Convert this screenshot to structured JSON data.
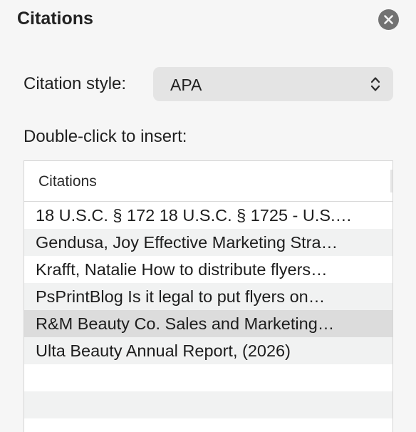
{
  "panel": {
    "title": "Citations"
  },
  "citation_style": {
    "label": "Citation style:",
    "selected": "APA"
  },
  "list": {
    "instruction": "Double-click to insert:",
    "column_header": "Citations",
    "items": [
      {
        "text": "18 U.S.C. § 172 18 U.S.C. § 1725 - U.S.…"
      },
      {
        "text": "Gendusa, Joy Effective Marketing Stra…"
      },
      {
        "text": "Krafft, Natalie How to distribute flyers…"
      },
      {
        "text": "PsPrintBlog Is it legal to put flyers on…"
      },
      {
        "text": "R&M Beauty Co. Sales and Marketing…"
      },
      {
        "text": "Ulta Beauty Annual Report, (2026)"
      }
    ]
  },
  "colors": {
    "panel_bg": "#f6f6f6",
    "selected_row": "#dcdcdc",
    "alt_row": "#f1f2f2",
    "close_button": "#727272"
  },
  "icons": {
    "close": "close-icon",
    "select_arrows": "chevron-up-down-icon"
  }
}
